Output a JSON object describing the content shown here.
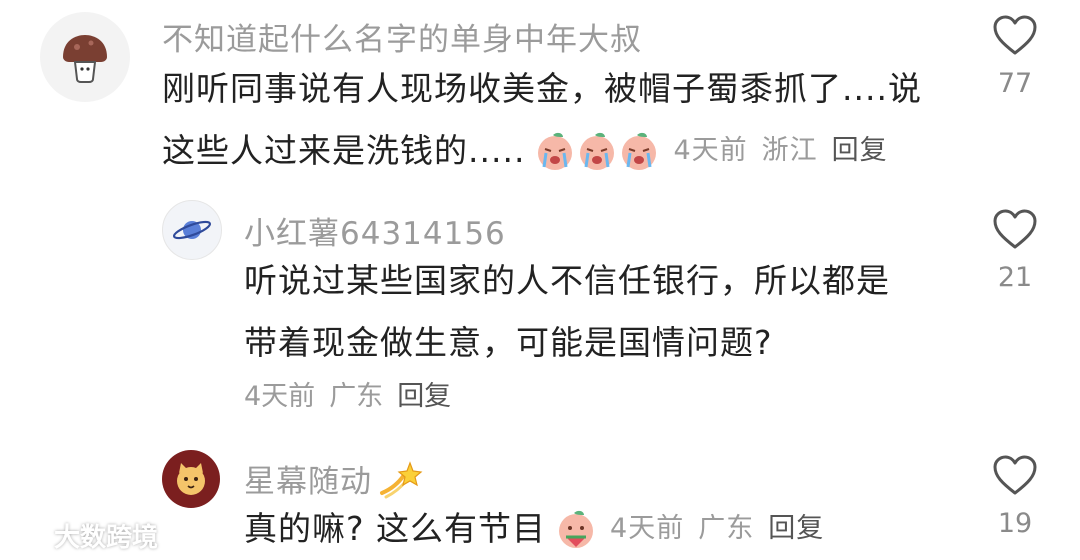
{
  "comments": [
    {
      "username": "不知道起什么名字的单身中年大叔",
      "content_line1": "刚听同事说有人现场收美金，被帽子蜀黍抓了....说",
      "content_line2": "这些人过来是洗钱的.....",
      "time": "4天前",
      "location": "浙江",
      "reply": "回复",
      "likes": "77",
      "avatar_icon": "mushroom-icon"
    },
    {
      "username": "小红薯64314156",
      "content_line1": "听说过某些国家的人不信任银行，所以都是",
      "content_line2": "带着现金做生意，可能是国情问题?",
      "time": "4天前",
      "location": "广东",
      "reply": "回复",
      "likes": "21",
      "avatar_icon": "planet-icon"
    },
    {
      "username": "星幕随动",
      "content_line1": "真的嘛? 这么有节目",
      "time": "4天前",
      "location": "广东",
      "reply": "回复",
      "likes": "19",
      "avatar_icon": "cat-face-icon",
      "name_badge_icon": "shooting-star-icon"
    }
  ],
  "watermark": {
    "text": "大数跨境"
  },
  "colors": {
    "username": "#9b9b9b",
    "text": "#222222",
    "meta": "#9b9b9b",
    "heart_stroke": "#555555"
  }
}
